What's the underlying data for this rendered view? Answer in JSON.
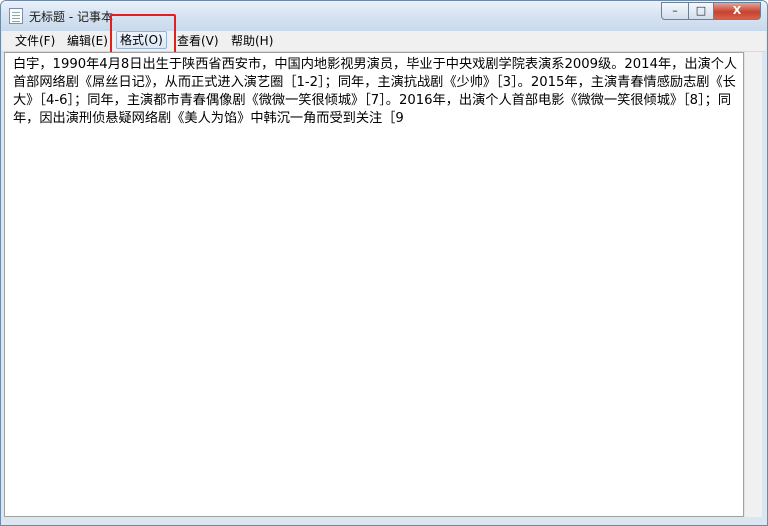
{
  "window": {
    "title": "无标题 - 记事本",
    "controls": {
      "minimize": "–",
      "maximize": "□",
      "close": "X"
    }
  },
  "menu": {
    "items": [
      {
        "label": "文件(F)"
      },
      {
        "label": "编辑(E)"
      },
      {
        "label": "格式(O)"
      },
      {
        "label": "查看(V)"
      },
      {
        "label": "帮助(H)"
      }
    ]
  },
  "editor": {
    "content": "白宇，1990年4月8日出生于陕西省西安市，中国内地影视男演员，毕业于中央戏剧学院表演系2009级。2014年，出演个人首部网络剧《屌丝日记》，从而正式进入演艺圈［1-2］；同年，主演抗战剧《少帅》［3］。2015年，主演青春情感励志剧《长大》［4-6］；同年，主演都市青春偶像剧《微微一笑很倾城》［7］。2016年，出演个人首部电影《微微一笑很倾城》［8］；同年，因出演刑侦悬疑网络剧《美人为馅》中韩沉一角而受到关注［9"
  },
  "colors": {
    "highlight": "#e02020"
  }
}
